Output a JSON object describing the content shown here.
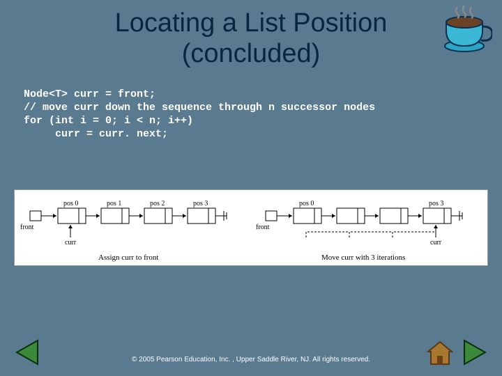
{
  "title_line1": "Locating a List Position",
  "title_line2": "(concluded)",
  "code": "Node<T> curr = front;\n// move curr down the sequence through n successor nodes\nfor (int i = 0; i < n; i++)\n     curr = curr. next;",
  "diagram": {
    "left": {
      "front_label": "front",
      "curr_label": "curr",
      "positions": [
        "pos 0",
        "pos 1",
        "pos 2",
        "pos 3"
      ],
      "caption": "Assign curr to front"
    },
    "right": {
      "front_label": "front",
      "curr_label": "curr",
      "positions": [
        "pos 0",
        "pos 3"
      ],
      "caption": "Move curr with 3 iterations"
    }
  },
  "footer": "© 2005 Pearson Education, Inc. , Upper Saddle River, NJ.  All rights reserved."
}
